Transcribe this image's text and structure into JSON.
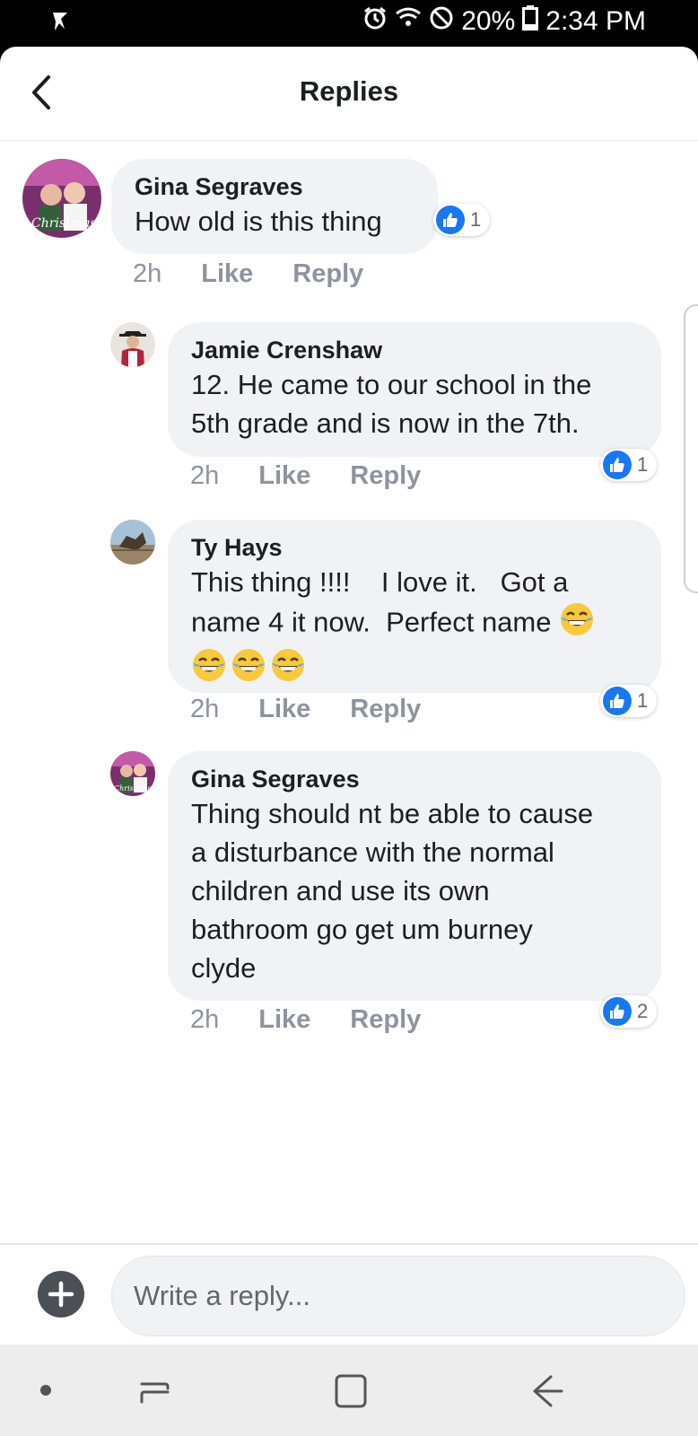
{
  "status_bar": {
    "battery": "20%",
    "time": "2:34 PM"
  },
  "header": {
    "title": "Replies"
  },
  "comments": [
    {
      "author": "Gina Segraves",
      "lines": [
        "How old is this thing"
      ],
      "time": "2h",
      "like_label": "Like",
      "reply_label": "Reply",
      "reaction_count": "1"
    },
    {
      "author": "Jamie Crenshaw",
      "lines": [
        "12. He came to our school in the",
        "5th grade and is now in the 7th."
      ],
      "time": "2h",
      "like_label": "Like",
      "reply_label": "Reply",
      "reaction_count": "1"
    },
    {
      "author": "Ty Hays",
      "lines": [
        "This thing !!!!    I love it.   Got a",
        "name 4 it now.  Perfect name"
      ],
      "time": "2h",
      "like_label": "Like",
      "reply_label": "Reply",
      "reaction_count": "1"
    },
    {
      "author": "Gina Segraves",
      "lines": [
        "Thing should nt be able to cause",
        "a disturbance with the normal",
        "children and use its own",
        "bathroom go get um burney",
        "clyde"
      ],
      "time": "2h",
      "like_label": "Like",
      "reply_label": "Reply",
      "reaction_count": "2"
    }
  ],
  "composer": {
    "placeholder": "Write a reply..."
  },
  "icons": {
    "accent": "#1877f2",
    "reaction_icon": "like-icon",
    "emoji": "face-with-tears-of-joy-icon"
  }
}
